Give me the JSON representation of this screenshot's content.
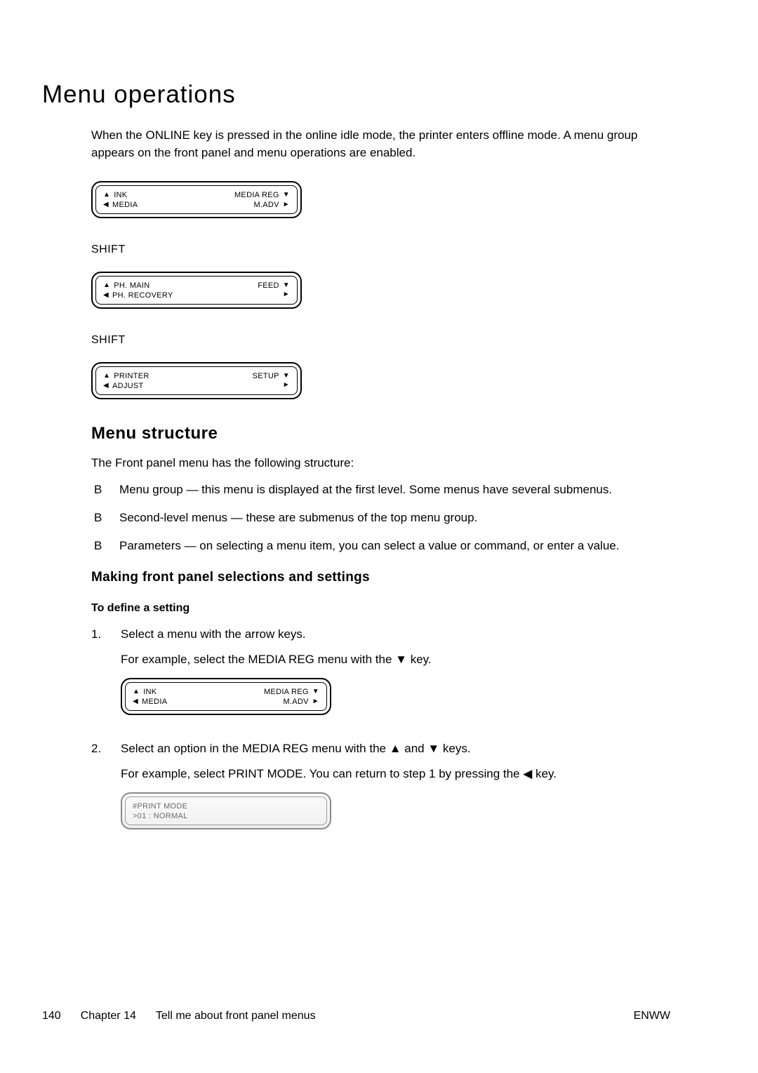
{
  "title": "Menu operations",
  "intro": "When the ONLINE key is pressed in the online idle mode, the printer enters offline mode. A menu group appears on the front panel and menu operations are enabled.",
  "shift_label": "SHIFT",
  "lcds": [
    {
      "tl": "INK",
      "bl": "MEDIA",
      "tr": "MEDIA REG",
      "br": "M.ADV"
    },
    {
      "tl": "PH. MAIN",
      "bl": "PH. RECOVERY",
      "tr": "FEED",
      "br": ""
    },
    {
      "tl": "PRINTER",
      "bl": "ADJUST",
      "tr": "SETUP",
      "br": ""
    }
  ],
  "menu_structure": {
    "heading": "Menu structure",
    "lead": "The Front panel menu has the following structure:",
    "items": [
      "Menu group — this menu is displayed at the first level. Some menus have several submenus.",
      "Second-level menus — these are submenus of the top menu group.",
      "Parameters — on selecting a menu item, you can select a value or command, or enter a value."
    ]
  },
  "selections": {
    "heading": "Making front panel selections and settings",
    "subheading": "To define a setting",
    "steps": {
      "s1": {
        "line1": "Select a menu with the arrow keys.",
        "line2_pre": "For example, select the MEDIA REG menu with the ",
        "line2_post": " key.",
        "lcd": {
          "tl": "INK",
          "bl": "MEDIA",
          "tr": "MEDIA REG",
          "br": "M.ADV"
        }
      },
      "s2": {
        "line1_pre": "Select an option in the MEDIA REG menu with the ",
        "line1_mid": " and ",
        "line1_post": " keys.",
        "line2_pre": "For example, select PRINT MODE. You can return to step 1 by pressing the ",
        "line2_post": " key.",
        "lcd_img": {
          "row1": "#PRINT MODE",
          "row2": ">01 : NORMAL"
        }
      }
    }
  },
  "glyphs": {
    "up": "▲",
    "down": "▼",
    "left": "◀",
    "right": "►"
  },
  "footer": {
    "page": "140",
    "chapter": "Chapter 14",
    "chapter_title": "Tell me about front panel menus",
    "right": "ENWW"
  }
}
